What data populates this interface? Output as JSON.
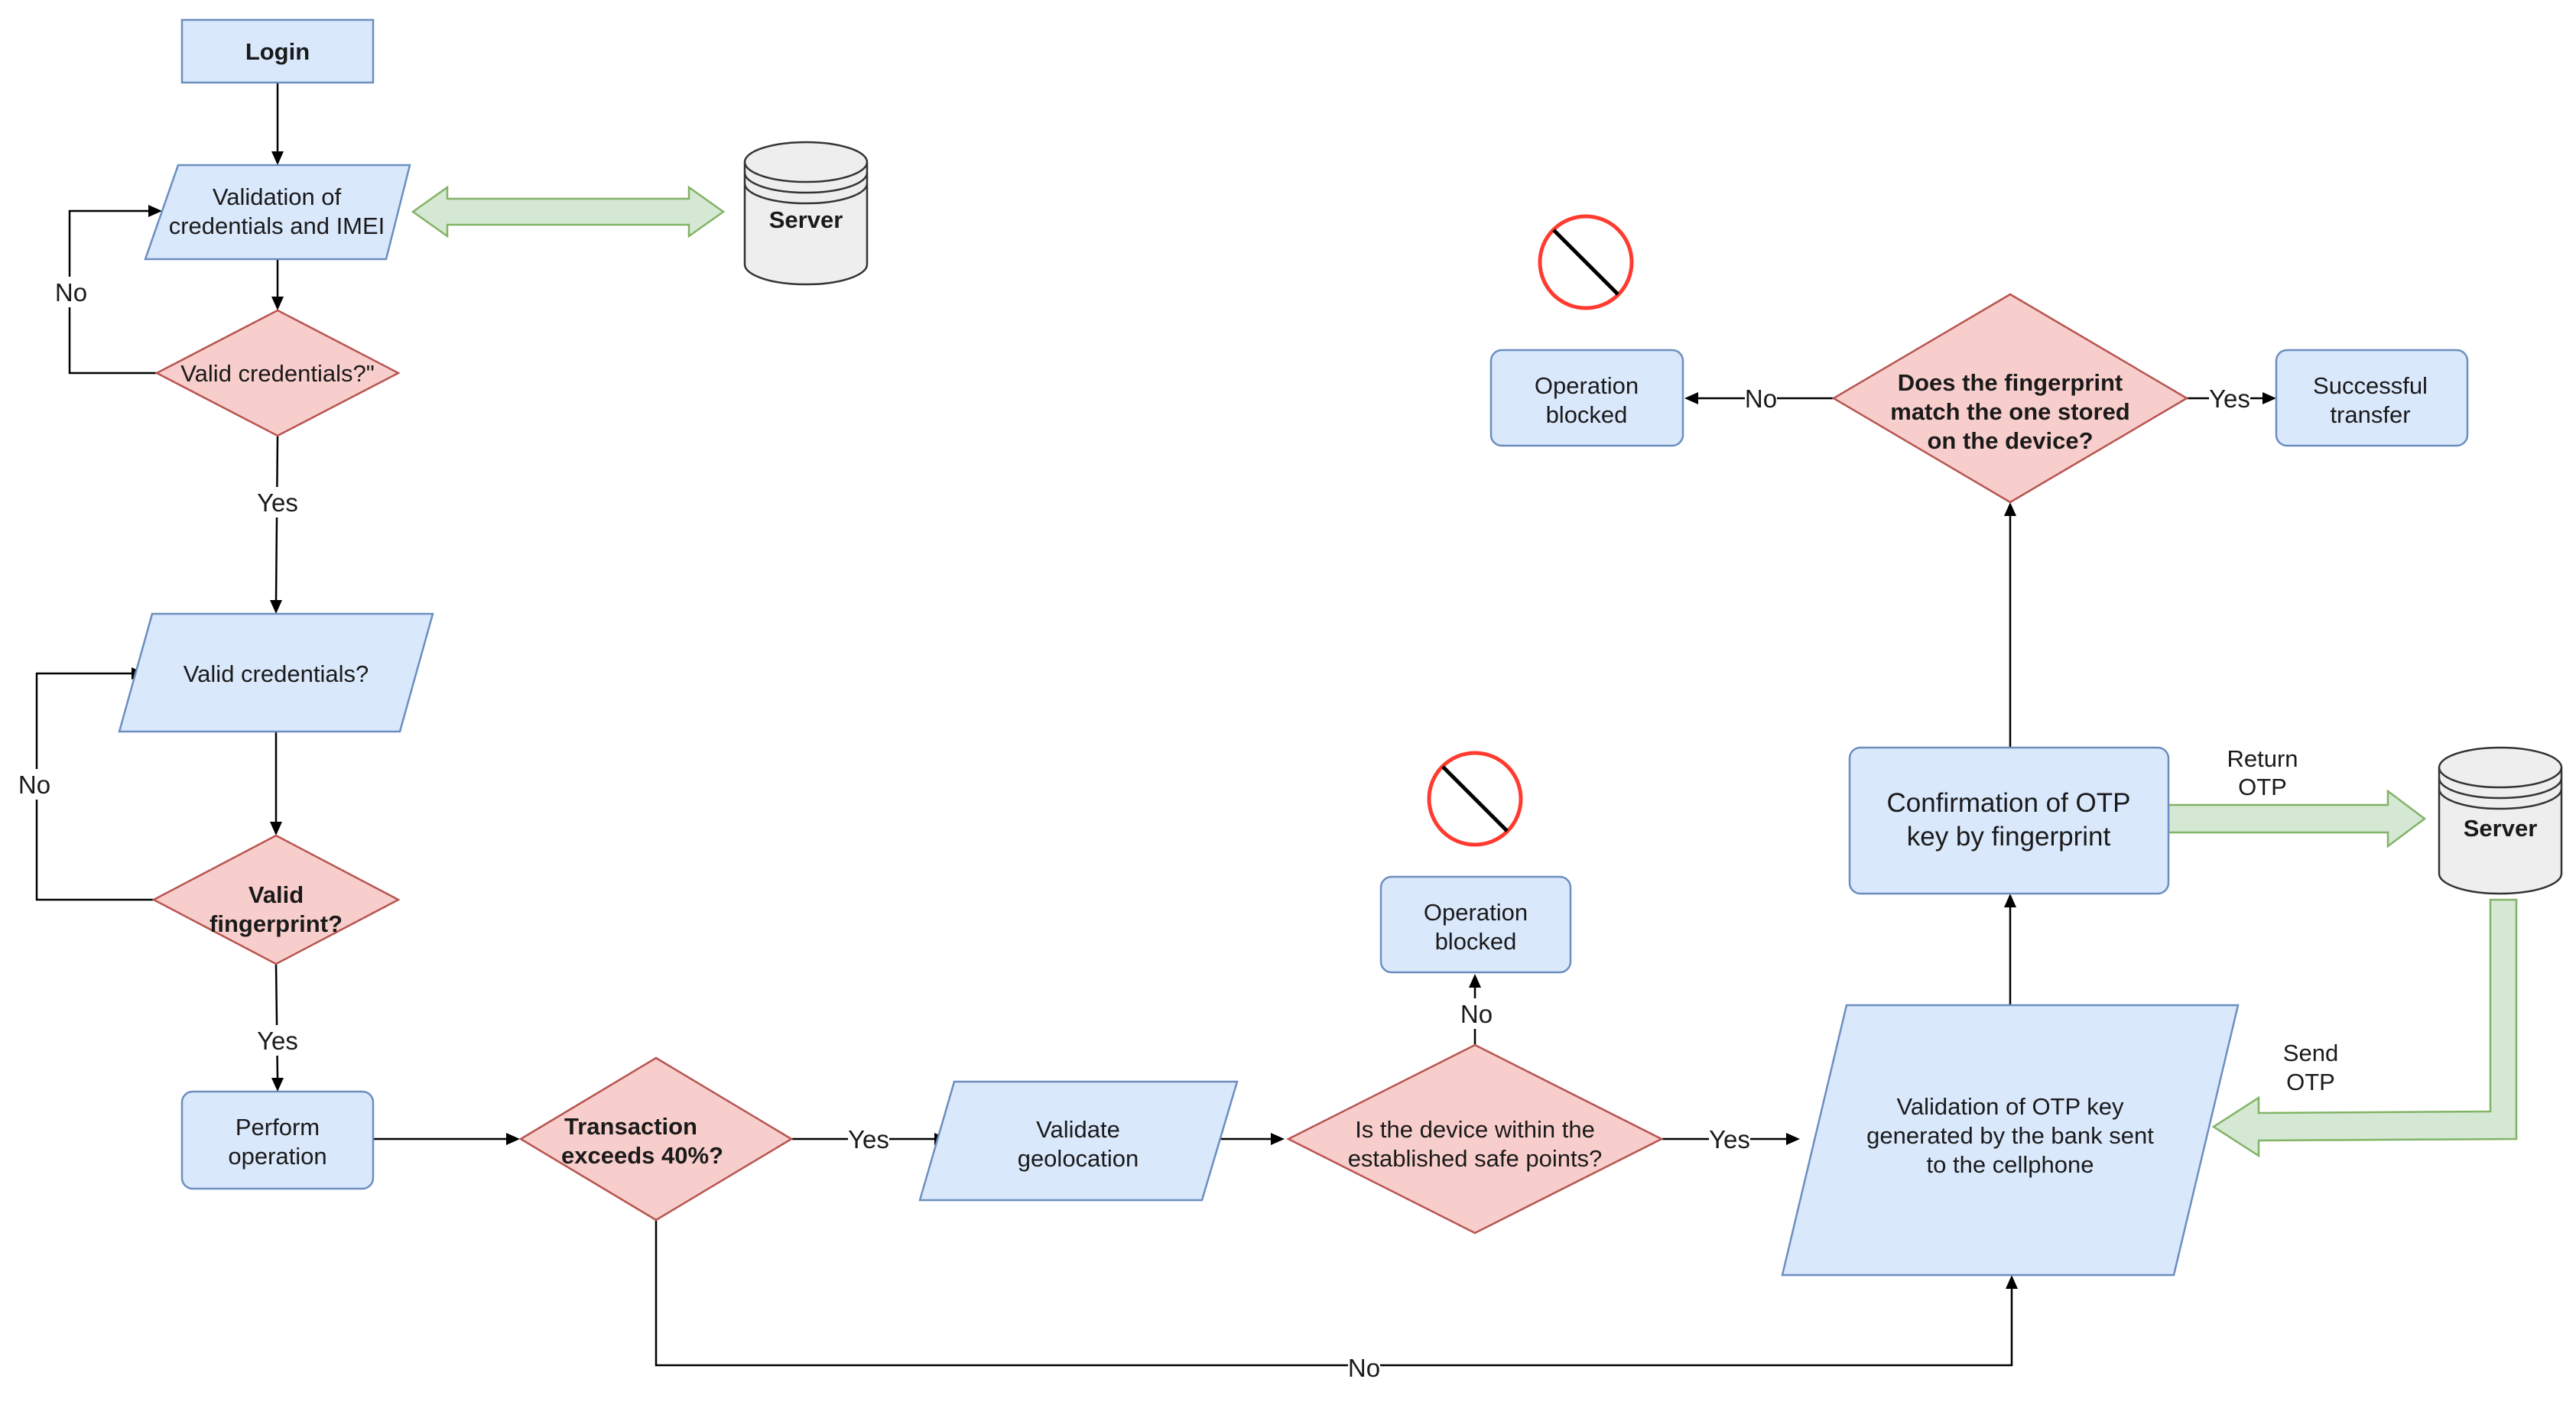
{
  "diagram": {
    "type": "flowchart",
    "nodes": {
      "login": {
        "label": "Login",
        "shape": "process"
      },
      "validate_credentials_imei": {
        "label": [
          "Validation of",
          "credentials and IMEI"
        ],
        "shape": "data"
      },
      "server_top": {
        "label": "Server",
        "shape": "database"
      },
      "valid_credentials_decision": {
        "label": "Valid credentials?\"",
        "shape": "decision"
      },
      "valid_credentials_input": {
        "label": "Valid credentials?",
        "shape": "data"
      },
      "valid_fingerprint_decision": {
        "label": [
          "Valid",
          "fingerprint?"
        ],
        "shape": "decision"
      },
      "perform_operation": {
        "label": [
          "Perform",
          "operation"
        ],
        "shape": "process"
      },
      "transaction_exceeds": {
        "label": [
          "Transaction",
          "exceeds 40%?"
        ],
        "shape": "decision"
      },
      "validate_geolocation": {
        "label": [
          "Validate",
          "geolocation"
        ],
        "shape": "data"
      },
      "device_safe_points": {
        "label": [
          "Is the device within the",
          "established safe points?"
        ],
        "shape": "decision"
      },
      "operation_blocked_geo": {
        "label": [
          "Operation",
          "blocked"
        ],
        "shape": "process"
      },
      "validation_otp": {
        "label": [
          "Validation of OTP key",
          "generated by the bank sent",
          "to the cellphone"
        ],
        "shape": "data"
      },
      "confirmation_otp": {
        "label": [
          "Confirmation of OTP",
          "key by fingerprint"
        ],
        "shape": "process"
      },
      "server_right": {
        "label": "Server",
        "shape": "database"
      },
      "fingerprint_match": {
        "label": [
          "Does the fingerprint",
          "match the one stored",
          "on the device?"
        ],
        "shape": "decision"
      },
      "operation_blocked_fp": {
        "label": [
          "Operation",
          "blocked"
        ],
        "shape": "process"
      },
      "successful_transfer": {
        "label": [
          "Successful",
          "transfer"
        ],
        "shape": "process"
      }
    },
    "edge_labels": {
      "cred_no": "No",
      "cred_yes": "Yes",
      "fp_no": "No",
      "fp_yes": "Yes",
      "tx_yes": "Yes",
      "tx_no": "No",
      "geo_no": "No",
      "geo_yes": "Yes",
      "match_no": "No",
      "match_yes": "Yes"
    },
    "flow_labels": {
      "return_otp": [
        "Return",
        "OTP"
      ],
      "send_otp": [
        "Send",
        "OTP"
      ]
    },
    "icons": {
      "blocked_icon_1": "no-entry-icon",
      "blocked_icon_2": "no-entry-icon"
    },
    "colors": {
      "process_fill": "#dae8fc",
      "process_stroke": "#6c8ebf",
      "decision_fill": "#f8cecc",
      "decision_stroke": "#b85450",
      "flow_fill": "#d5e8d4",
      "flow_stroke": "#82b366",
      "database_fill": "#eeeeee",
      "no_entry": "#ff3b30"
    }
  }
}
